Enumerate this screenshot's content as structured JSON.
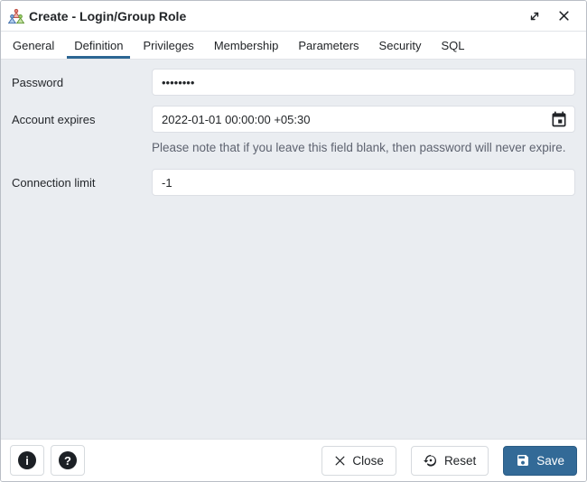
{
  "window": {
    "title": "Create - Login/Group Role"
  },
  "tabs": [
    {
      "label": "General",
      "active": false
    },
    {
      "label": "Definition",
      "active": true
    },
    {
      "label": "Privileges",
      "active": false
    },
    {
      "label": "Membership",
      "active": false
    },
    {
      "label": "Parameters",
      "active": false
    },
    {
      "label": "Security",
      "active": false
    },
    {
      "label": "SQL",
      "active": false
    }
  ],
  "form": {
    "password": {
      "label": "Password",
      "value": "••••••••"
    },
    "account_expires": {
      "label": "Account expires",
      "value": "2022-01-01 00:00:00 +05:30",
      "note": "Please note that if you leave this field blank, then password will never expire."
    },
    "connection_limit": {
      "label": "Connection limit",
      "value": "-1"
    }
  },
  "footer": {
    "info_glyph": "i",
    "help_glyph": "?",
    "close_label": "Close",
    "reset_label": "Reset",
    "save_label": "Save"
  },
  "icons": {
    "group_role": "three-colored-user-triangles",
    "expand": "diagonal-resize-arrows",
    "window_close": "x-mark",
    "calendar": "calendar-date-picker",
    "info": "info-circle",
    "help": "question-circle",
    "close": "x-mark",
    "reset": "restore-arrow-with-dot",
    "save": "floppy-disk"
  },
  "colors": {
    "primary": "#336a97",
    "tab_underline": "#2c6693",
    "content_bg": "#eaedf1",
    "note_text": "#5e6370"
  }
}
